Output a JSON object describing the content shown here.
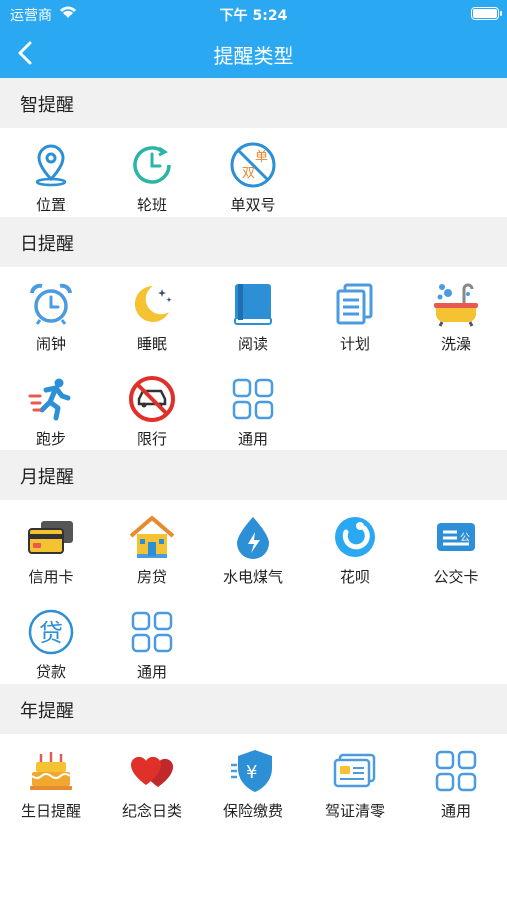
{
  "status_bar": {
    "carrier": "运营商",
    "time": "下午 5:24"
  },
  "nav": {
    "title": "提醒类型"
  },
  "sections": [
    {
      "title": "智提醒",
      "items": [
        {
          "label": "位置",
          "icon": "location-pin-icon"
        },
        {
          "label": "轮班",
          "icon": "clock-cycle-icon"
        },
        {
          "label": "单双号",
          "icon": "odd-even-plate-icon",
          "badge_top": "单",
          "badge_bottom": "双"
        }
      ]
    },
    {
      "title": "日提醒",
      "items": [
        {
          "label": "闹钟",
          "icon": "alarm-clock-icon"
        },
        {
          "label": "睡眠",
          "icon": "moon-icon"
        },
        {
          "label": "阅读",
          "icon": "book-icon"
        },
        {
          "label": "计划",
          "icon": "documents-icon"
        },
        {
          "label": "洗澡",
          "icon": "bathtub-icon"
        },
        {
          "label": "跑步",
          "icon": "runner-icon"
        },
        {
          "label": "限行",
          "icon": "no-car-icon"
        },
        {
          "label": "通用",
          "icon": "grid-icon"
        }
      ]
    },
    {
      "title": "月提醒",
      "items": [
        {
          "label": "信用卡",
          "icon": "credit-card-icon"
        },
        {
          "label": "房贷",
          "icon": "house-icon"
        },
        {
          "label": "水电煤气",
          "icon": "utilities-drop-icon"
        },
        {
          "label": "花呗",
          "icon": "huabei-icon"
        },
        {
          "label": "公交卡",
          "icon": "bus-card-icon",
          "badge": "公"
        },
        {
          "label": "贷款",
          "icon": "loan-icon",
          "badge": "贷"
        },
        {
          "label": "通用",
          "icon": "grid-icon"
        }
      ]
    },
    {
      "title": "年提醒",
      "items": [
        {
          "label": "生日提醒",
          "icon": "birthday-cake-icon"
        },
        {
          "label": "纪念日类",
          "icon": "hearts-icon"
        },
        {
          "label": "保险缴费",
          "icon": "insurance-shield-icon",
          "badge": "¥"
        },
        {
          "label": "驾证清零",
          "icon": "license-card-icon"
        },
        {
          "label": "通用",
          "icon": "grid-icon"
        }
      ]
    }
  ],
  "colors": {
    "nav_blue": "#2aa8f2",
    "icon_blue": "#2d8fd6",
    "header_bg": "#f1f1f1"
  }
}
